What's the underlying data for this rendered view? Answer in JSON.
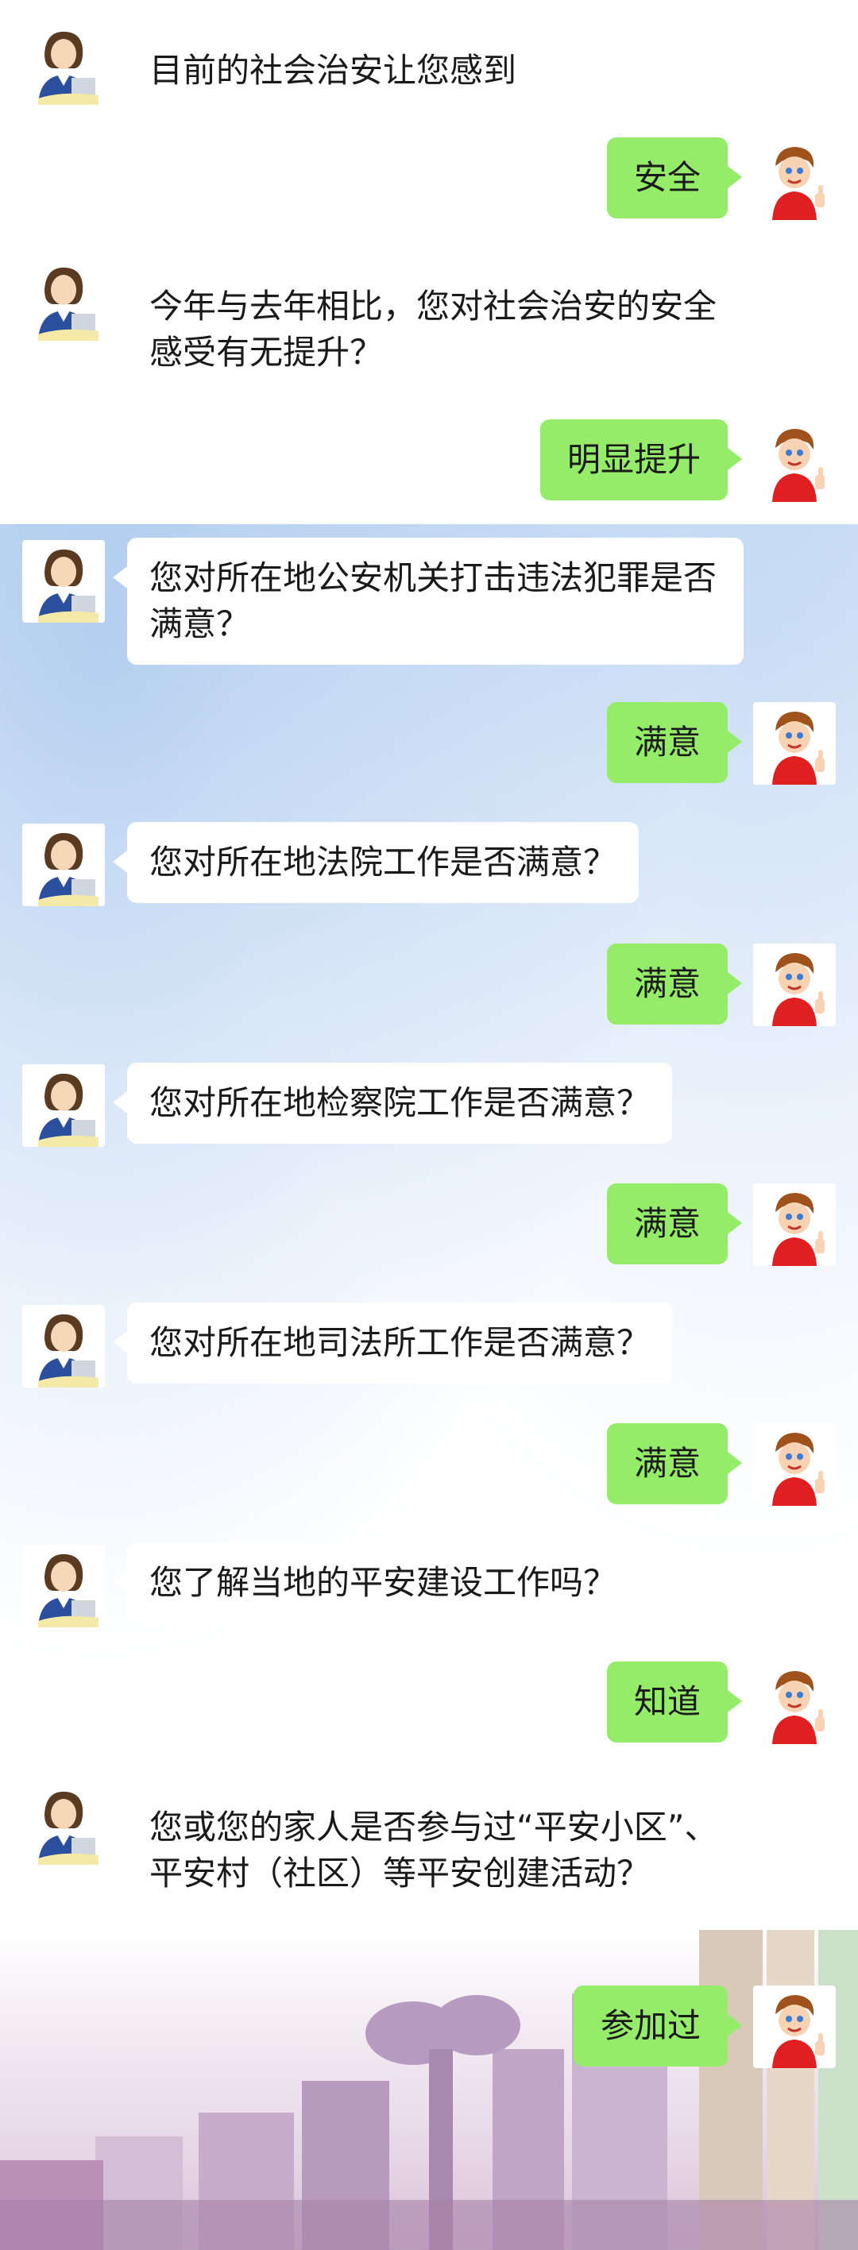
{
  "colors": {
    "answer_bubble": "#95ec69",
    "question_bubble": "#ffffff"
  },
  "icons": {
    "agent": "woman-agent-avatar",
    "user": "boy-thumbs-up-avatar"
  },
  "conversation": [
    {
      "q": "目前的社会治安让您感到",
      "a": "安全"
    },
    {
      "q": "今年与去年相比，您对社会治安的安全感受有无提升？",
      "a": "明显提升"
    },
    {
      "q": "您对所在地公安机关打击违法犯罪是否满意？",
      "a": "满意"
    },
    {
      "q": "您对所在地法院工作是否满意？",
      "a": "满意"
    },
    {
      "q": "您对所在地检察院工作是否满意？",
      "a": "满意"
    },
    {
      "q": "您对所在地司法所工作是否满意？",
      "a": "满意"
    },
    {
      "q": "您了解当地的平安建设工作吗？",
      "a": "知道"
    },
    {
      "q": "您或您的家人是否参与过“平安小区”、平安村（社区）等平安创建活动？",
      "a": "参加过"
    }
  ]
}
